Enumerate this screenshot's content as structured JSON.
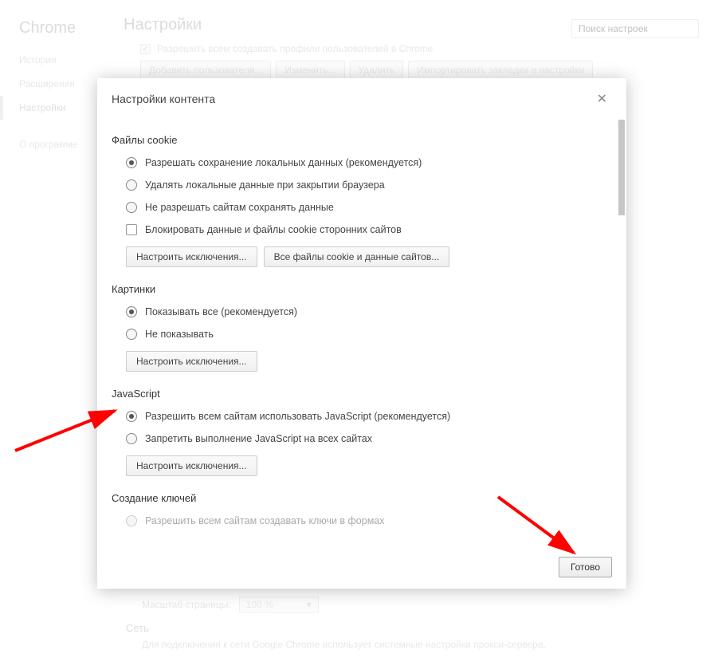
{
  "app_name": "Chrome",
  "page_title": "Настройки",
  "search_placeholder": "Поиск настроек",
  "sidebar": {
    "history": "История",
    "extensions": "Расширения",
    "settings": "Настройки",
    "about": "О программе"
  },
  "bg": {
    "allow_profiles": "Разрешить всем создавать профили пользователей в Chrome",
    "add_user_btn": "Добавить пользователя...",
    "edit_btn": "Изменить...",
    "delete_btn": "Удалить",
    "import_btn": "Импортировать закладки и настройки",
    "zoom_label": "Масштаб страницы:",
    "zoom_value": "100 %",
    "network_heading": "Сеть",
    "network_desc": "Для подключения к сети Google Chrome использует системные настройки прокси-сервера."
  },
  "modal": {
    "title": "Настройки контента",
    "done_btn": "Готово",
    "cookies": {
      "heading": "Файлы cookie",
      "opt1": "Разрешать сохранение локальных данных (рекомендуется)",
      "opt2": "Удалять локальные данные при закрытии браузера",
      "opt3": "Не разрешать сайтам сохранять данные",
      "block_third": "Блокировать данные и файлы cookie сторонних сайтов",
      "exceptions_btn": "Настроить исключения...",
      "all_cookies_btn": "Все файлы cookie и данные сайтов..."
    },
    "images": {
      "heading": "Картинки",
      "opt1": "Показывать все (рекомендуется)",
      "opt2": "Не показывать",
      "exceptions_btn": "Настроить исключения..."
    },
    "javascript": {
      "heading": "JavaScript",
      "opt1": "Разрешить всем сайтам использовать JavaScript (рекомендуется)",
      "opt2": "Запретить выполнение JavaScript на всех сайтах",
      "exceptions_btn": "Настроить исключения..."
    },
    "keys": {
      "heading": "Создание ключей",
      "opt1": "Разрешить всем сайтам создавать ключи в формах"
    }
  }
}
